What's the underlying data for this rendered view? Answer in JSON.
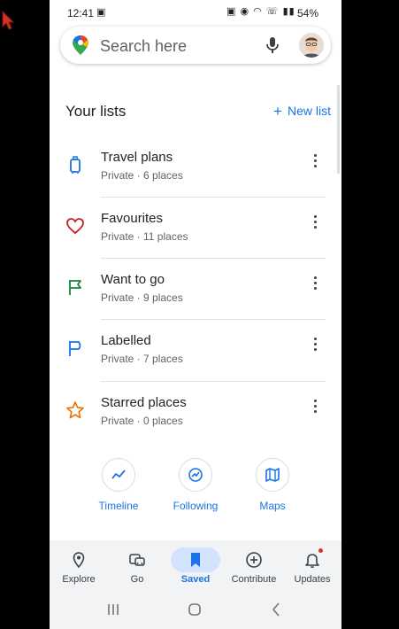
{
  "status": {
    "time": "12:41",
    "battery": "54%"
  },
  "search": {
    "placeholder": "Search here"
  },
  "lists_section": {
    "title": "Your lists",
    "new_list_label": "New list"
  },
  "lists": [
    {
      "title": "Travel plans",
      "subtitle": "Private · 6 places",
      "icon": "suitcase-icon",
      "color": "#1a73e8"
    },
    {
      "title": "Favourites",
      "subtitle": "Private · 11 places",
      "icon": "heart-icon",
      "color": "#c5221f"
    },
    {
      "title": "Want to go",
      "subtitle": "Private · 9 places",
      "icon": "flag-icon",
      "color": "#188038"
    },
    {
      "title": "Labelled",
      "subtitle": "Private · 7 places",
      "icon": "label-flag-icon",
      "color": "#1a73e8"
    },
    {
      "title": "Starred places",
      "subtitle": "Private · 0 places",
      "icon": "star-icon",
      "color": "#e37400"
    }
  ],
  "quick_actions": [
    {
      "label": "Timeline",
      "icon": "timeline-icon"
    },
    {
      "label": "Following",
      "icon": "following-icon"
    },
    {
      "label": "Maps",
      "icon": "map-icon"
    }
  ],
  "bottom_nav": [
    {
      "label": "Explore",
      "icon": "location-pin-icon",
      "active": false
    },
    {
      "label": "Go",
      "icon": "commute-icon",
      "active": false
    },
    {
      "label": "Saved",
      "icon": "bookmark-icon",
      "active": true
    },
    {
      "label": "Contribute",
      "icon": "add-circle-icon",
      "active": false
    },
    {
      "label": "Updates",
      "icon": "bell-icon",
      "active": false
    }
  ],
  "colors": {
    "accent": "#1a73e8",
    "nav_background": "#f1f3f4",
    "active_pill": "#d3e3fd"
  }
}
